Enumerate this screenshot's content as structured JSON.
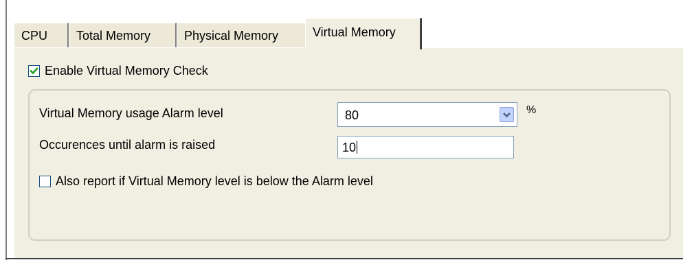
{
  "tabs": [
    {
      "label": "CPU",
      "active": false
    },
    {
      "label": "Total Memory",
      "active": false
    },
    {
      "label": "Physical Memory",
      "active": false
    },
    {
      "label": "Virtual Memory",
      "active": true
    }
  ],
  "enable_check": {
    "label": "Enable Virtual Memory Check",
    "checked": true
  },
  "alarm_level": {
    "label": "Virtual Memory usage Alarm level",
    "value": "80",
    "unit": "%"
  },
  "occurrences": {
    "label": "Occurences until alarm is raised",
    "value": "10"
  },
  "report_below": {
    "label": "Also report if Virtual Memory level is below the Alarm level",
    "checked": false
  },
  "colors": {
    "panel": "#f1efe2",
    "check_mark": "#21a121",
    "field_border": "#7f9db9"
  }
}
